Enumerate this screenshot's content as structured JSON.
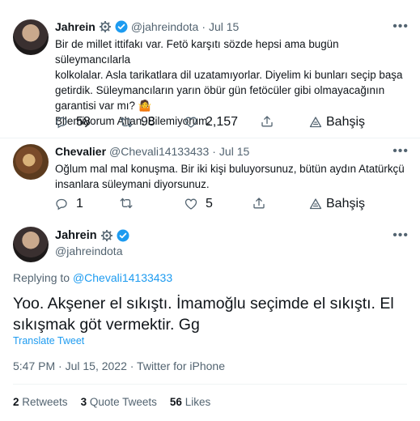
{
  "tweet1": {
    "name": "Jahrein",
    "handle": "@jahreindota",
    "separator": "·",
    "time": "Jul 15",
    "text": "Bir de millet ittifakı var. Fetö karşıtı sözde hepsi ama bugün süleymancılarla\nkolkolalar. Asla tarikatlara dil uzatamıyorlar. Diyelim ki bunları seçip başa\ngetirdik. Süleymancıların yarın öbür gün fetöcüler gibi olmayacağının\ngarantisi var mı? 🤷\nBilemiyorum Altan. Bilemiyorum.",
    "replies": "58",
    "retweets": "98",
    "likes": "2,157",
    "share_label": "Bahşiş"
  },
  "tweet2": {
    "name": "Chevalier",
    "handle": "@Chevali14133433",
    "separator": "·",
    "time": "Jul 15",
    "text": "Oğlum mal mal konuşma. Bir iki kişi buluyorsunuz, bütün aydın Atatürkçü\ninsanlara süleymani diyorsunuz.",
    "replies": "1",
    "retweets": "",
    "likes": "5",
    "share_label": "Bahşiş"
  },
  "main": {
    "name": "Jahrein",
    "handle": "@jahreindota",
    "replying_prefix": "Replying to",
    "replying_to": "@Chevali14133433",
    "text": "Yoo. Akşener el sıkıştı. İmamoğlu seçimde el sıkıştı. El sıkışmak göt vermektir. Gg",
    "translate": "Translate Tweet",
    "timestamp": "5:47 PM · Jul 15, 2022 · Twitter for iPhone",
    "retweets_count": "2",
    "retweets_label": "Retweets",
    "quotes_count": "3",
    "quotes_label": "Quote Tweets",
    "likes_count": "56",
    "likes_label": "Likes"
  },
  "colors": {
    "accent": "#1d9bf0",
    "muted": "#536471",
    "text": "#0f1419"
  }
}
